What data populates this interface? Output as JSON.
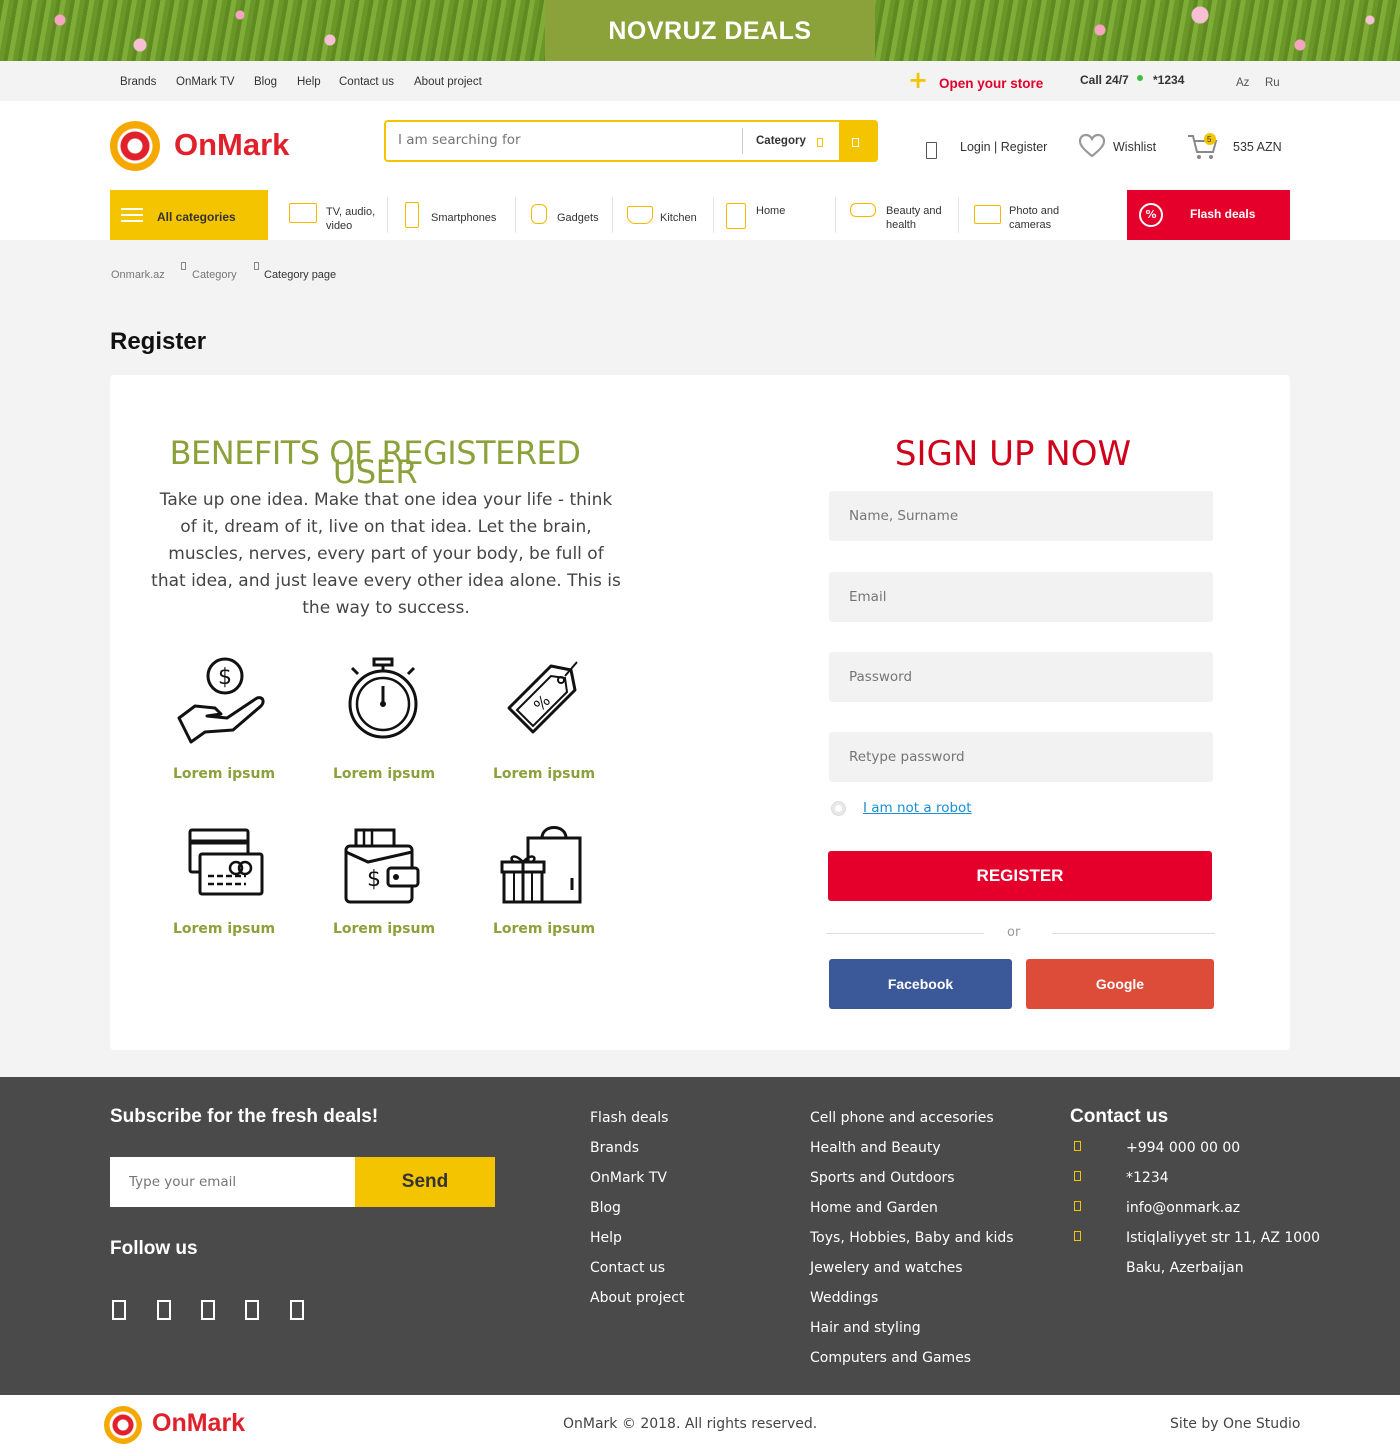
{
  "banner": {
    "text": "NOVRUZ DEALS"
  },
  "topbar": {
    "links": [
      "Brands",
      "OnMark TV",
      "Blog",
      "Help",
      "Contact us",
      "About project"
    ],
    "open_store": "Open your store",
    "call_label": "Call 24/7",
    "call_number": "*1234",
    "languages": [
      "Az",
      "Ru"
    ]
  },
  "header": {
    "logo": "OnMark",
    "search_placeholder": "I am searching for",
    "search_category": "Category",
    "login_register": "Login | Register",
    "wishlist": "Wishlist",
    "cart_count": "5",
    "cart_total": "535 AZN"
  },
  "nav": {
    "all_categories": "All categories",
    "items": [
      {
        "label": "TV, audio, video",
        "icon": "tv-icon"
      },
      {
        "label": "Smartphones",
        "icon": "smartphone-icon"
      },
      {
        "label": "Gadgets",
        "icon": "watch-icon"
      },
      {
        "label": "Kitchen",
        "icon": "pot-icon"
      },
      {
        "label": "Home",
        "icon": "washing-machine-icon"
      },
      {
        "label": "Beauty and health",
        "icon": "hair-dryer-icon"
      },
      {
        "label": "Photo and cameras",
        "icon": "camera-icon"
      }
    ],
    "flash_deals": "Flash deals"
  },
  "breadcrumb": [
    "Onmark.az",
    "Category",
    "Category page"
  ],
  "page_title": "Register",
  "benefits": {
    "title_line1": "BENEFITS OF  REGISTERED",
    "title_line2": "USER",
    "text": "Take up one idea. Make that one idea your life - think of it, dream of it, live on that idea. Let the brain, muscles, nerves, every part of your body, be full of that idea, and just leave every other idea alone. This is the way to success.",
    "items": [
      {
        "label": "Lorem ipsum",
        "icon": "money-hand-icon"
      },
      {
        "label": "Lorem ipsum",
        "icon": "stopwatch-icon"
      },
      {
        "label": "Lorem ipsum",
        "icon": "discount-tag-icon"
      },
      {
        "label": "Lorem ipsum",
        "icon": "credit-card-icon"
      },
      {
        "label": "Lorem ipsum",
        "icon": "wallet-icon"
      },
      {
        "label": "Lorem ipsum",
        "icon": "gift-bag-icon"
      }
    ]
  },
  "signup": {
    "title": "SIGN UP NOW",
    "name_placeholder": "Name, Surname",
    "email_placeholder": "Email",
    "password_placeholder": "Password",
    "retype_placeholder": "Retype password",
    "robot": "I am not a robot",
    "register": "REGISTER",
    "or": "or",
    "facebook": "Facebook",
    "google": "Google"
  },
  "footer": {
    "subscribe_title": "Subscribe for the fresh deals!",
    "email_placeholder": "Type your email",
    "send": "Send",
    "follow_title": "Follow us",
    "links1": [
      "Flash deals",
      "Brands",
      "OnMark TV",
      "Blog",
      "Help",
      "Contact us",
      "About project"
    ],
    "links2": [
      "Cell phone and accesories",
      "Health and Beauty",
      "Sports and Outdoors",
      "Home and Garden",
      "Toys, Hobbies, Baby and kids",
      "Jewelery and watches",
      "Weddings",
      "Hair and styling",
      "Computers and Games"
    ],
    "contact_title": "Contact us",
    "phone": "+994 000 00 00",
    "short": "*1234",
    "email": "info@onmark.az",
    "address1": "Istiqlaliyyet str 11, AZ 1000",
    "address2": "Baku, Azerbaijan"
  },
  "bottom": {
    "logo": "OnMark",
    "copyright": "OnMark © 2018. All rights reserved.",
    "studio": "Site by One Studio"
  },
  "colors": {
    "brand_red": "#e4002b",
    "brand_yellow": "#f5c400",
    "benefit_green": "#8ba13a",
    "facebook": "#3b5998",
    "google": "#dd4b39"
  }
}
